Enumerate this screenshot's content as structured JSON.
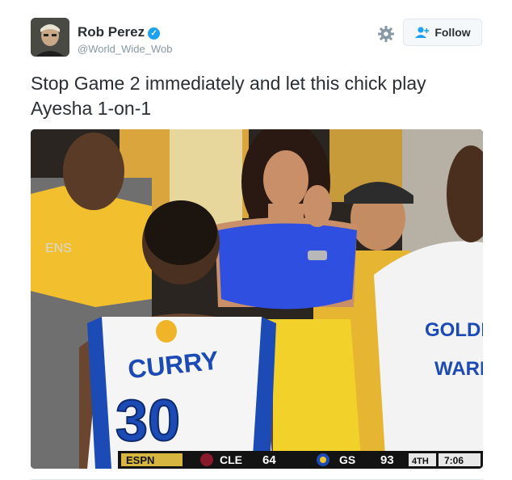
{
  "author": {
    "name": "Rob Perez",
    "handle": "@World_Wide_Wob",
    "verified": true
  },
  "actions": {
    "follow_label": "Follow",
    "settings_icon": "gear-icon"
  },
  "tweet": {
    "text_line1": "Stop Game 2 immediately and let this chick play",
    "text_line2": "Ayesha 1-on-1"
  },
  "photo": {
    "jersey_name": "CURRY",
    "jersey_number": "30",
    "shirt_text1": "GOLDE",
    "shirt_text2": "WARI",
    "scorebug": {
      "network": "ESPN",
      "team1": "CLE",
      "score1": "64",
      "team2": "GS",
      "score2": "93",
      "period": "4TH",
      "clock": "7:06"
    }
  },
  "colors": {
    "accent": "#1da1f2",
    "text": "#292f33",
    "muted": "#8899a6",
    "warriors_blue": "#1d4bb5",
    "warriors_gold": "#f4c22b",
    "dress_blue": "#2e4fe0"
  }
}
